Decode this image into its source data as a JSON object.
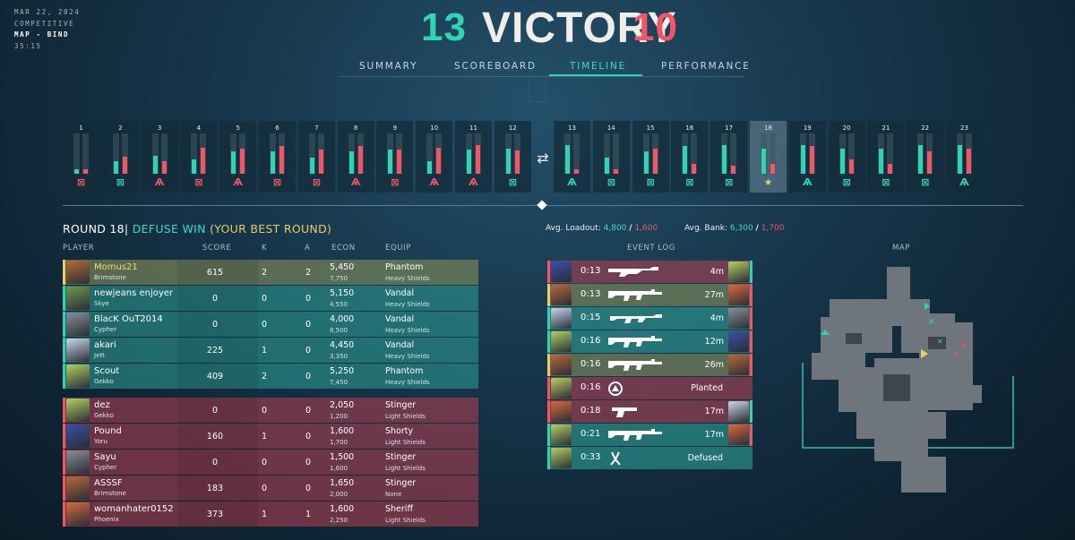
{
  "match": {
    "date": "MAR 22, 2024",
    "mode": "COMPETITIVE",
    "map": "MAP - BIND",
    "duration": "35:15"
  },
  "score": {
    "ally": "13",
    "result": "VICTORY",
    "enemy": "10"
  },
  "tabs": [
    "SUMMARY",
    "SCOREBOARD",
    "TIMELINE",
    "PERFORMANCE"
  ],
  "active_tab": "TIMELINE",
  "colors": {
    "ally": "#2fd5b3",
    "enemy": "#f25563",
    "highlight": "#e6cf63"
  },
  "rounds": [
    {
      "n": "1",
      "icon": "skull",
      "side": "e",
      "a": 0.12,
      "e": 0.1
    },
    {
      "n": "2",
      "icon": "skull",
      "side": "a",
      "a": 0.3,
      "e": 0.42
    },
    {
      "n": "3",
      "icon": "spike",
      "side": "e",
      "a": 0.45,
      "e": 0.3
    },
    {
      "n": "4",
      "icon": "skull",
      "side": "e",
      "a": 0.35,
      "e": 0.65
    },
    {
      "n": "5",
      "icon": "spike",
      "side": "e",
      "a": 0.55,
      "e": 0.62
    },
    {
      "n": "6",
      "icon": "skull",
      "side": "e",
      "a": 0.55,
      "e": 0.68
    },
    {
      "n": "7",
      "icon": "skull",
      "side": "e",
      "a": 0.4,
      "e": 0.6
    },
    {
      "n": "8",
      "icon": "spike",
      "side": "e",
      "a": 0.55,
      "e": 0.68
    },
    {
      "n": "9",
      "icon": "skull",
      "side": "e",
      "a": 0.6,
      "e": 0.6
    },
    {
      "n": "10",
      "icon": "spike",
      "side": "e",
      "a": 0.3,
      "e": 0.65
    },
    {
      "n": "11",
      "icon": "spike",
      "side": "e",
      "a": 0.6,
      "e": 0.72
    },
    {
      "n": "12",
      "icon": "skull",
      "side": "a",
      "a": 0.62,
      "e": 0.58
    },
    {
      "n": "13",
      "icon": "spike",
      "side": "a",
      "a": 0.72,
      "e": 0.12
    },
    {
      "n": "14",
      "icon": "skull",
      "side": "a",
      "a": 0.4,
      "e": 0.12
    },
    {
      "n": "15",
      "icon": "skull",
      "side": "a",
      "a": 0.55,
      "e": 0.62
    },
    {
      "n": "16",
      "icon": "skull",
      "side": "a",
      "a": 0.7,
      "e": 0.25
    },
    {
      "n": "17",
      "icon": "skull",
      "side": "a",
      "a": 0.72,
      "e": 0.2
    },
    {
      "n": "18",
      "icon": "star",
      "side": "h",
      "a": 0.62,
      "e": 0.25
    },
    {
      "n": "19",
      "icon": "spike",
      "side": "a",
      "a": 0.72,
      "e": 0.68
    },
    {
      "n": "20",
      "icon": "skull",
      "side": "a",
      "a": 0.62,
      "e": 0.35
    },
    {
      "n": "21",
      "icon": "skull",
      "side": "a",
      "a": 0.62,
      "e": 0.25
    },
    {
      "n": "22",
      "icon": "skull",
      "side": "a",
      "a": 0.72,
      "e": 0.55
    },
    {
      "n": "23",
      "icon": "spike",
      "side": "a",
      "a": 0.72,
      "e": 0.62
    }
  ],
  "round_detail": {
    "title": "ROUND 18|",
    "result": " DEFUSE WIN",
    "best": " (YOUR BEST ROUND)",
    "avg_loadout_label": "Avg. Loadout:",
    "avg_loadout_ally": "4,800",
    "avg_loadout_enemy": "1,600",
    "avg_bank_label": "Avg. Bank:",
    "avg_bank_ally": "6,300",
    "avg_bank_enemy": "1,700",
    "slash": "/"
  },
  "scoreboard_headers": {
    "player": "PLAYER",
    "score": "SCORE",
    "k": "K",
    "a": "A",
    "econ": "ECON",
    "equip": "EQUIP"
  },
  "players": [
    {
      "name": "Momus21",
      "agent": "Brimstone",
      "score": "615",
      "k": "2",
      "a": "2",
      "econ": "5,450",
      "econ2": "7,750",
      "weapon": "Phantom",
      "shield": "Heavy Shields",
      "team": "me",
      "color": "#b86a3a"
    },
    {
      "name": "newjeans enjoyer",
      "agent": "Skye",
      "score": "0",
      "k": "0",
      "a": "0",
      "econ": "5,150",
      "econ2": "4,550",
      "weapon": "Vandal",
      "shield": "Heavy Shields",
      "team": "ally",
      "color": "#6f9a4a"
    },
    {
      "name": "BlacK OuT2014",
      "agent": "Cypher",
      "score": "0",
      "k": "0",
      "a": "0",
      "econ": "4,000",
      "econ2": "8,500",
      "weapon": "Vandal",
      "shield": "Heavy Shields",
      "team": "ally",
      "color": "#8a8f98"
    },
    {
      "name": "akari",
      "agent": "Jett",
      "score": "225",
      "k": "1",
      "a": "0",
      "econ": "4,450",
      "econ2": "3,350",
      "weapon": "Vandal",
      "shield": "Heavy Shields",
      "team": "ally",
      "color": "#c8d8e8"
    },
    {
      "name": "Scout",
      "agent": "Gekko",
      "score": "409",
      "k": "2",
      "a": "0",
      "econ": "5,250",
      "econ2": "7,450",
      "weapon": "Phantom",
      "shield": "Heavy Shields",
      "team": "ally",
      "color": "#b4d060"
    },
    {
      "name": "dez",
      "agent": "Gekko",
      "score": "0",
      "k": "0",
      "a": "0",
      "econ": "2,050",
      "econ2": "1,200",
      "weapon": "Stinger",
      "shield": "Light Shields",
      "team": "enemy",
      "color": "#b4d060"
    },
    {
      "name": "Pound",
      "agent": "Yoru",
      "score": "160",
      "k": "1",
      "a": "0",
      "econ": "1,600",
      "econ2": "1,700",
      "weapon": "Shorty",
      "shield": "Light Shields",
      "team": "enemy",
      "color": "#3a4fa8"
    },
    {
      "name": "Sayu",
      "agent": "Cypher",
      "score": "0",
      "k": "0",
      "a": "0",
      "econ": "1,500",
      "econ2": "1,600",
      "weapon": "Stinger",
      "shield": "Light Shields",
      "team": "enemy",
      "color": "#8a8f98"
    },
    {
      "name": "ASSSF",
      "agent": "Brimstone",
      "score": "183",
      "k": "0",
      "a": "0",
      "econ": "1,650",
      "econ2": "2,000",
      "weapon": "Stinger",
      "shield": "None",
      "team": "enemy",
      "color": "#b86a3a"
    },
    {
      "name": "womanhater0152",
      "agent": "Phoenix",
      "score": "373",
      "k": "1",
      "a": "1",
      "econ": "1,600",
      "econ2": "2,250",
      "weapon": "Sheriff",
      "shield": "Light Shields",
      "team": "enemy",
      "color": "#d86a3a"
    }
  ],
  "event_log_header": "EVENT LOG",
  "events": [
    {
      "time": "0:13",
      "weapon": "shotgun",
      "dist": "4m",
      "type": "enemy",
      "lc": "#f25563",
      "rc": "#2fd5b3",
      "la": "#3a4fa8",
      "ra": "#b4d060"
    },
    {
      "time": "0:13",
      "weapon": "rifle",
      "dist": "27m",
      "type": "me",
      "lc": "#e6cf63",
      "rc": "#f25563",
      "la": "#b86a3a",
      "ra": "#d86a3a"
    },
    {
      "time": "0:15",
      "weapon": "vandal",
      "dist": "4m",
      "type": "ally",
      "lc": "#2fd5b3",
      "rc": "#f25563",
      "la": "#c8d8e8",
      "ra": "#8a8f98"
    },
    {
      "time": "0:16",
      "weapon": "rifle",
      "dist": "12m",
      "type": "ally",
      "lc": "#2fd5b3",
      "rc": "#f25563",
      "la": "#b4d060",
      "ra": "#3a4fa8"
    },
    {
      "time": "0:16",
      "weapon": "rifle",
      "dist": "26m",
      "type": "me",
      "lc": "#e6cf63",
      "rc": "#f25563",
      "la": "#b86a3a",
      "ra": "#b86a3a"
    },
    {
      "time": "0:16",
      "weapon": "spike",
      "action": "Planted",
      "type": "enemy",
      "lc": "#f25563",
      "la": "#b4d060"
    },
    {
      "time": "0:18",
      "weapon": "pistol",
      "dist": "17m",
      "type": "enemy",
      "lc": "#f25563",
      "rc": "#2fd5b3",
      "la": "#d86a3a",
      "ra": "#c8d8e8"
    },
    {
      "time": "0:21",
      "weapon": "rifle",
      "dist": "17m",
      "type": "ally",
      "lc": "#2fd5b3",
      "rc": "#f25563",
      "la": "#b4d060",
      "ra": "#d86a3a"
    },
    {
      "time": "0:33",
      "weapon": "defuser",
      "action": "Defused",
      "type": "ally",
      "lc": "#2fd5b3",
      "la": "#b4d060"
    }
  ],
  "map_header": "MAP"
}
